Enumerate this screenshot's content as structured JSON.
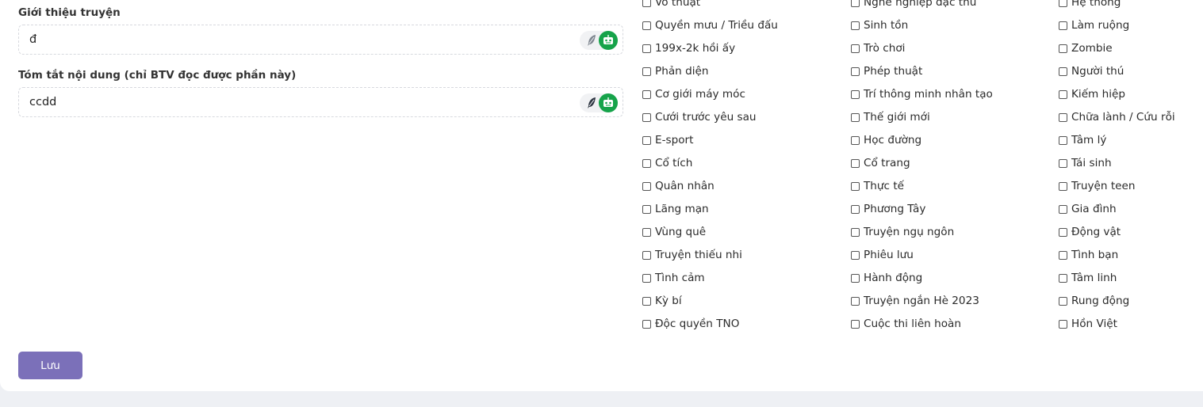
{
  "form": {
    "intro_label": "Giới thiệu truyện",
    "intro_value": "đ",
    "summary_label": "Tóm tắt nội dung (chỉ BTV đọc được phần này)",
    "summary_value": "ccdd",
    "save_label": "Lưu"
  },
  "genres": {
    "columns": [
      [
        "Võ thuật",
        "Quyền mưu / Triều đấu",
        "199x-2k hồi ấy",
        "Phản diện",
        "Cơ giới máy móc",
        "Cưới trước yêu sau",
        "E-sport",
        "Cổ tích",
        "Quân nhân",
        "Lãng mạn",
        "Vùng quê",
        "Truyện thiếu nhi",
        "Tình cảm",
        "Kỳ bí",
        "Độc quyền TNO"
      ],
      [
        "Nghề nghiệp đặc thù",
        "Sinh tồn",
        "Trò chơi",
        "Phép thuật",
        "Trí thông minh nhân tạo",
        "Thế giới mới",
        "Học đường",
        "Cổ trang",
        "Thực tế",
        "Phương Tây",
        "Truyện ngụ ngôn",
        "Phiêu lưu",
        "Hành động",
        "Truyện ngắn Hè 2023",
        "Cuộc thi liên hoàn"
      ],
      [
        "Hệ thống",
        "Làm ruộng",
        "Zombie",
        "Người thú",
        "Kiếm hiệp",
        "Chữa lành / Cứu rỗi",
        "Tâm lý",
        "Tái sinh",
        "Truyện teen",
        "Gia đình",
        "Động vật",
        "Tình bạn",
        "Tâm linh",
        "Rung động",
        "Hồn Việt"
      ]
    ]
  },
  "colors": {
    "accent_button": "#7b70b9",
    "toggle_active": "#16a34a",
    "page_background": "#eef0f4"
  },
  "icons": [
    "feather-icon",
    "robot-icon"
  ]
}
